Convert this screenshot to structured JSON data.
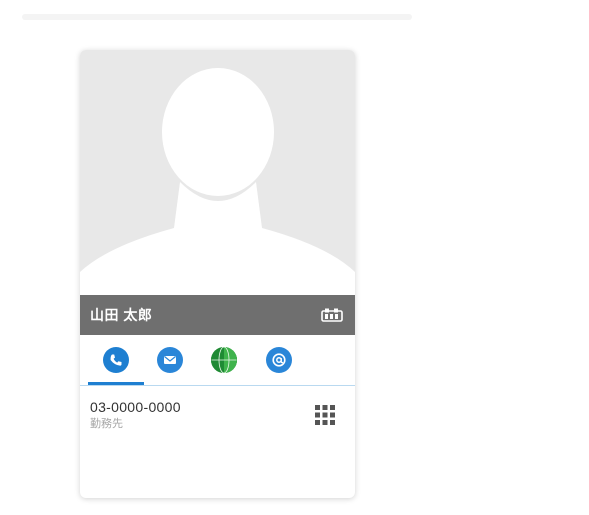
{
  "contact": {
    "name": "山田 太郎",
    "phone_number": "03-0000-0000",
    "phone_label": "勤務先"
  },
  "icons": {
    "vcard": "vcard-icon",
    "phone": "phone-icon",
    "mail": "mail-icon",
    "web": "globe-icon",
    "email_at": "at-icon",
    "keypad": "keypad-icon"
  },
  "tabs": {
    "active": "phone"
  },
  "colors": {
    "name_bar": "#6f6f6f",
    "accent_blue": "#1e7fd1",
    "globe_green": "#2d9d3a",
    "photo_bg": "#e8e8e8"
  }
}
